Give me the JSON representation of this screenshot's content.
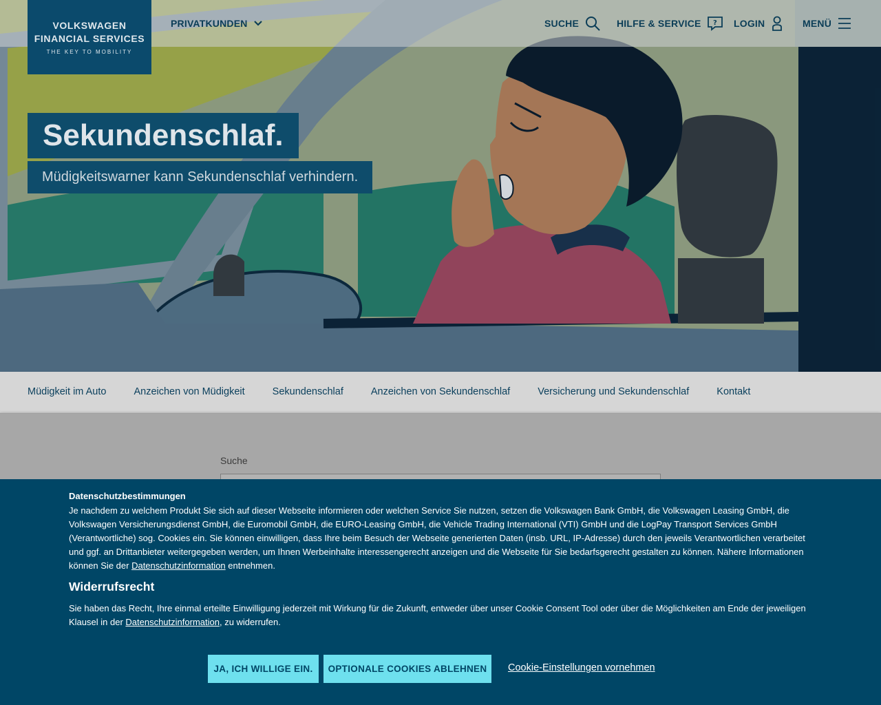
{
  "brand": {
    "line1": "VOLKSWAGEN",
    "line2": "FINANCIAL SERVICES",
    "tagline": "THE KEY TO MOBILITY",
    "color": "#0b4a6c"
  },
  "topnav": {
    "customer_segment": "PRIVATKUNDEN",
    "search": "SUCHE",
    "help": "HILFE & SERVICE",
    "login": "LOGIN",
    "menu": "MENÜ"
  },
  "hero": {
    "title": "Sekundenschlaf.",
    "subtitle": "Müdigkeitswarner kann Sekundenschlaf verhindern."
  },
  "subnav": {
    "items": [
      "Müdigkeit im Auto",
      "Anzeichen von Müdigkeit",
      "Sekundenschlaf",
      "Anzeichen von Sekundenschlaf",
      "Versicherung und Sekundenschlaf",
      "Kontakt"
    ]
  },
  "search": {
    "label": "Suche",
    "value": ""
  },
  "cookie": {
    "title": "Datenschutzbestimmungen",
    "text_before_link": "Je nachdem zu welchem Produkt Sie sich auf dieser Webseite informieren oder welchen Service Sie nutzen, setzen die Volkswagen Bank GmbH, die Volkswagen Leasing GmbH, die Volkswagen Versicherungsdienst GmbH, die Euromobil GmbH, die EURO-Leasing GmbH, die Vehicle Trading International (VTI) GmbH und die LogPay Transport Services GmbH (Verantwortliche) sog. Cookies ein. Sie können einwilligen, dass Ihre beim Besuch der Webseite generierten Daten (insb. URL, IP-Adresse) durch den jeweils Verantwortlichen verarbeitet und ggf. an Drittanbieter weitergegeben werden, um Ihnen Werbeinhalte interessengerecht anzeigen und die Webseite für Sie bedarfsgerecht gestalten zu können. Nähere Informationen können Sie der ",
    "link1": "Datenschutzinformation",
    "text_after_link": " entnehmen.",
    "revocation_heading": "Widerrufsrecht",
    "revocation_before_link": "Sie haben das Recht, Ihre einmal erteilte Einwilligung jederzeit mit Wirkung für die Zukunft, entweder über unser Cookie Consent Tool oder über die Möglichkeiten am Ende der jeweiligen Klausel in der ",
    "link2": "Datenschutzinformation",
    "revocation_after_link": ", zu widerrufen.",
    "accept_button": "JA, ICH WILLIGE EIN.",
    "decline_button": "OPTIONALE COOKIES ABLEHNEN",
    "settings_link": "Cookie-Einstellungen vornehmen",
    "background": "#004666",
    "button_color": "#6ee0ee"
  }
}
